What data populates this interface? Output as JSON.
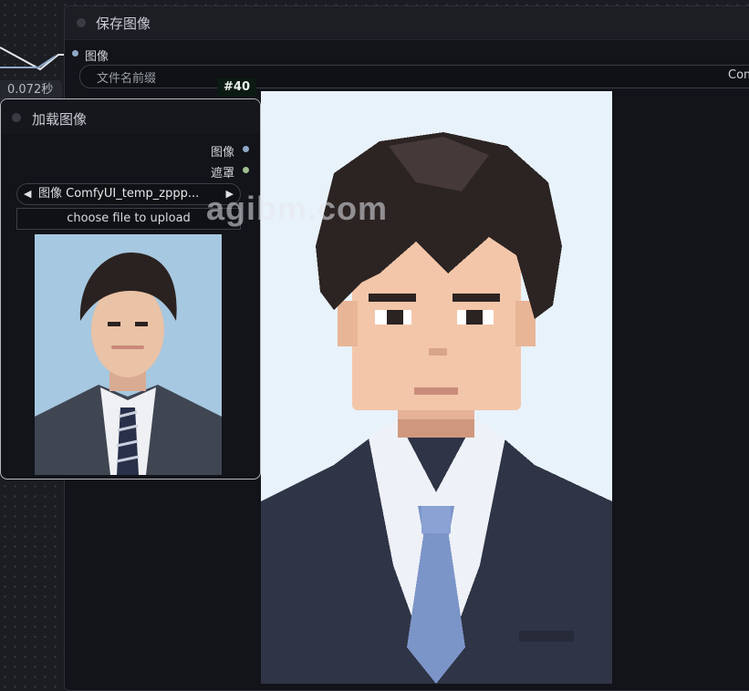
{
  "save_node": {
    "title": "保存图像",
    "input_label": "图像",
    "prefix_label": "文件名前缀",
    "prefix_value": "Com"
  },
  "timing_badge": "0.072秒",
  "node_id_badge": "#40",
  "load_node": {
    "title": "加载图像",
    "outputs": [
      "图像",
      "遮罩"
    ],
    "image_combo": {
      "label": "图像",
      "value": "ComfyUI_temp_zppp..."
    },
    "upload_button": "choose file to upload"
  },
  "watermark": "agibm.com",
  "colors": {
    "image_port": "#8fa8c8",
    "mask_port": "#9fc08f",
    "node_id_bg": "#0b1a12"
  }
}
